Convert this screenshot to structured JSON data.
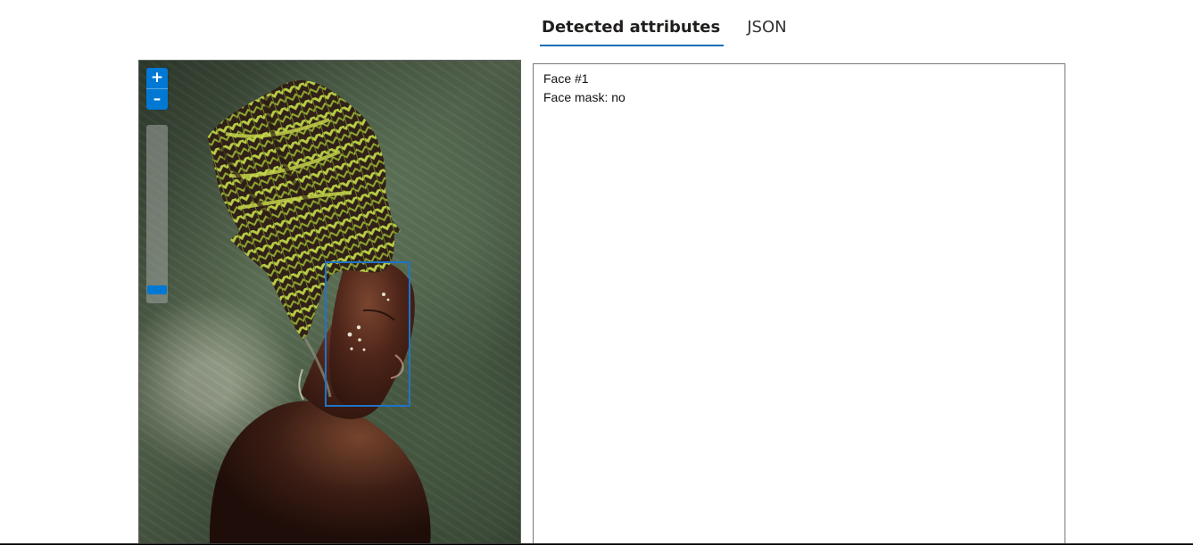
{
  "tabs": [
    {
      "label": "Detected attributes",
      "active": true
    },
    {
      "label": "JSON",
      "active": false
    }
  ],
  "viewer": {
    "zoom_in_label": "+",
    "zoom_out_label": "–",
    "zoom_level": 0.1,
    "detected_region_color": "#1f73c8"
  },
  "results": {
    "lines": [
      "Face #1",
      "Face mask: no"
    ]
  },
  "colors": {
    "accent": "#0f6cbd",
    "control_blue": "#0078d4",
    "face_box": "#1f73c8"
  },
  "icons": {
    "zoom_in": "plus-icon",
    "zoom_out": "minus-icon"
  }
}
